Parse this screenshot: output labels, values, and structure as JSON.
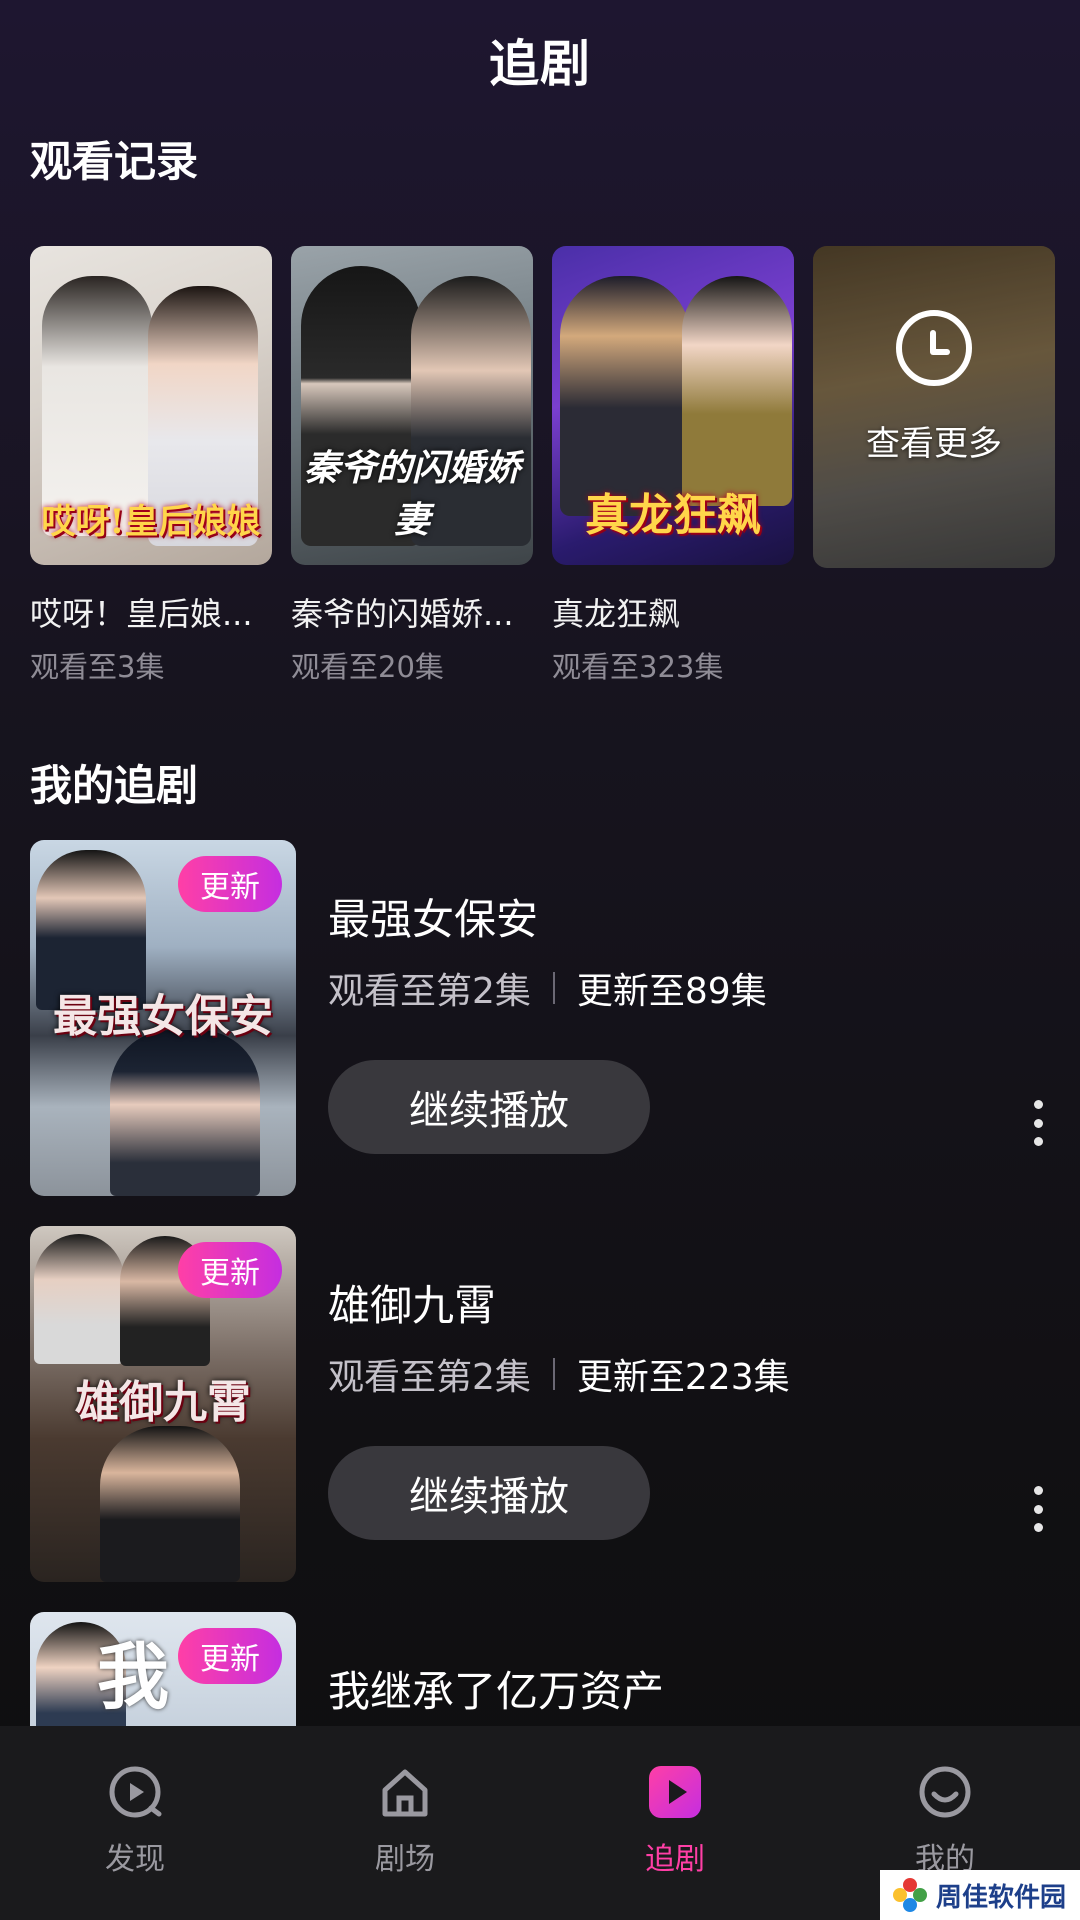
{
  "header": {
    "title": "追剧"
  },
  "history": {
    "section_title": "观看记录",
    "items": [
      {
        "title": "哎呀！皇后娘...",
        "progress": "观看至3集",
        "poster_text": "哎呀!皇后娘娘"
      },
      {
        "title": "秦爷的闪婚娇...",
        "progress": "观看至20集",
        "poster_text": "秦爷的闪婚娇妻"
      },
      {
        "title": "真龙狂飙",
        "progress": "观看至323集",
        "poster_text": "真龙狂飙"
      }
    ],
    "more_label": "查看更多"
  },
  "following": {
    "section_title": "我的追剧",
    "items": [
      {
        "title": "最强女保安",
        "watched": "观看至第2集",
        "updated": "更新至89集",
        "badge": "更新",
        "button": "继续播放",
        "poster_text": "最强女保安"
      },
      {
        "title": "雄御九霄",
        "watched": "观看至第2集",
        "updated": "更新至223集",
        "badge": "更新",
        "button": "继续播放",
        "poster_text": "雄御九霄"
      },
      {
        "title": "我继承了亿万资产",
        "badge": "更新",
        "poster_text": "我"
      }
    ]
  },
  "nav": {
    "items": [
      {
        "label": "发现",
        "icon": "discover-icon"
      },
      {
        "label": "剧场",
        "icon": "home-icon"
      },
      {
        "label": "追剧",
        "icon": "play-icon",
        "active": true
      },
      {
        "label": "我的",
        "icon": "profile-icon"
      }
    ]
  },
  "watermark": {
    "text": "周佳软件园"
  },
  "colors": {
    "accent": "#ff3fa6",
    "badge_end": "#c52ee0",
    "button_bg": "#39383d",
    "nav_bg": "#1a1a1c"
  }
}
